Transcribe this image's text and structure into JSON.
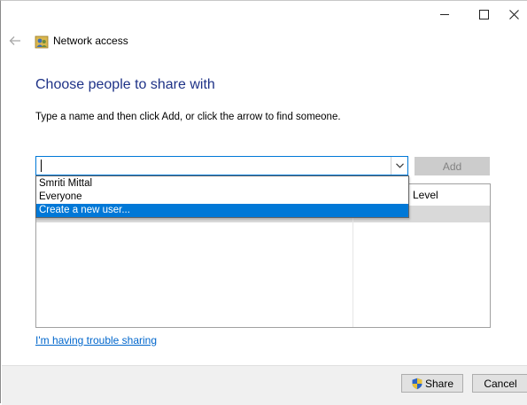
{
  "window": {
    "title": "Network access",
    "caption_buttons": [
      "minimize",
      "maximize",
      "close"
    ]
  },
  "header": {
    "back_icon": "back-arrow-icon",
    "app_icon": "network-users-icon"
  },
  "main": {
    "heading": "Choose people to share with",
    "instructions": "Type a name and then click Add, or click the arrow to find someone.",
    "combo": {
      "value": "",
      "dropdown_open": true
    },
    "add_button": "Add",
    "dropdown_options": [
      "Smriti Mittal",
      "Everyone",
      "Create a new user..."
    ],
    "selected_option_index": 2,
    "table": {
      "column_level": "Level"
    },
    "trouble_link": "I'm having trouble sharing"
  },
  "footer": {
    "share_button": "Share",
    "cancel_button": "Cancel"
  },
  "colors": {
    "heading": "#1e3287",
    "accent": "#0078d7",
    "link": "#0066cc",
    "disabled_button": "#cccccc"
  }
}
